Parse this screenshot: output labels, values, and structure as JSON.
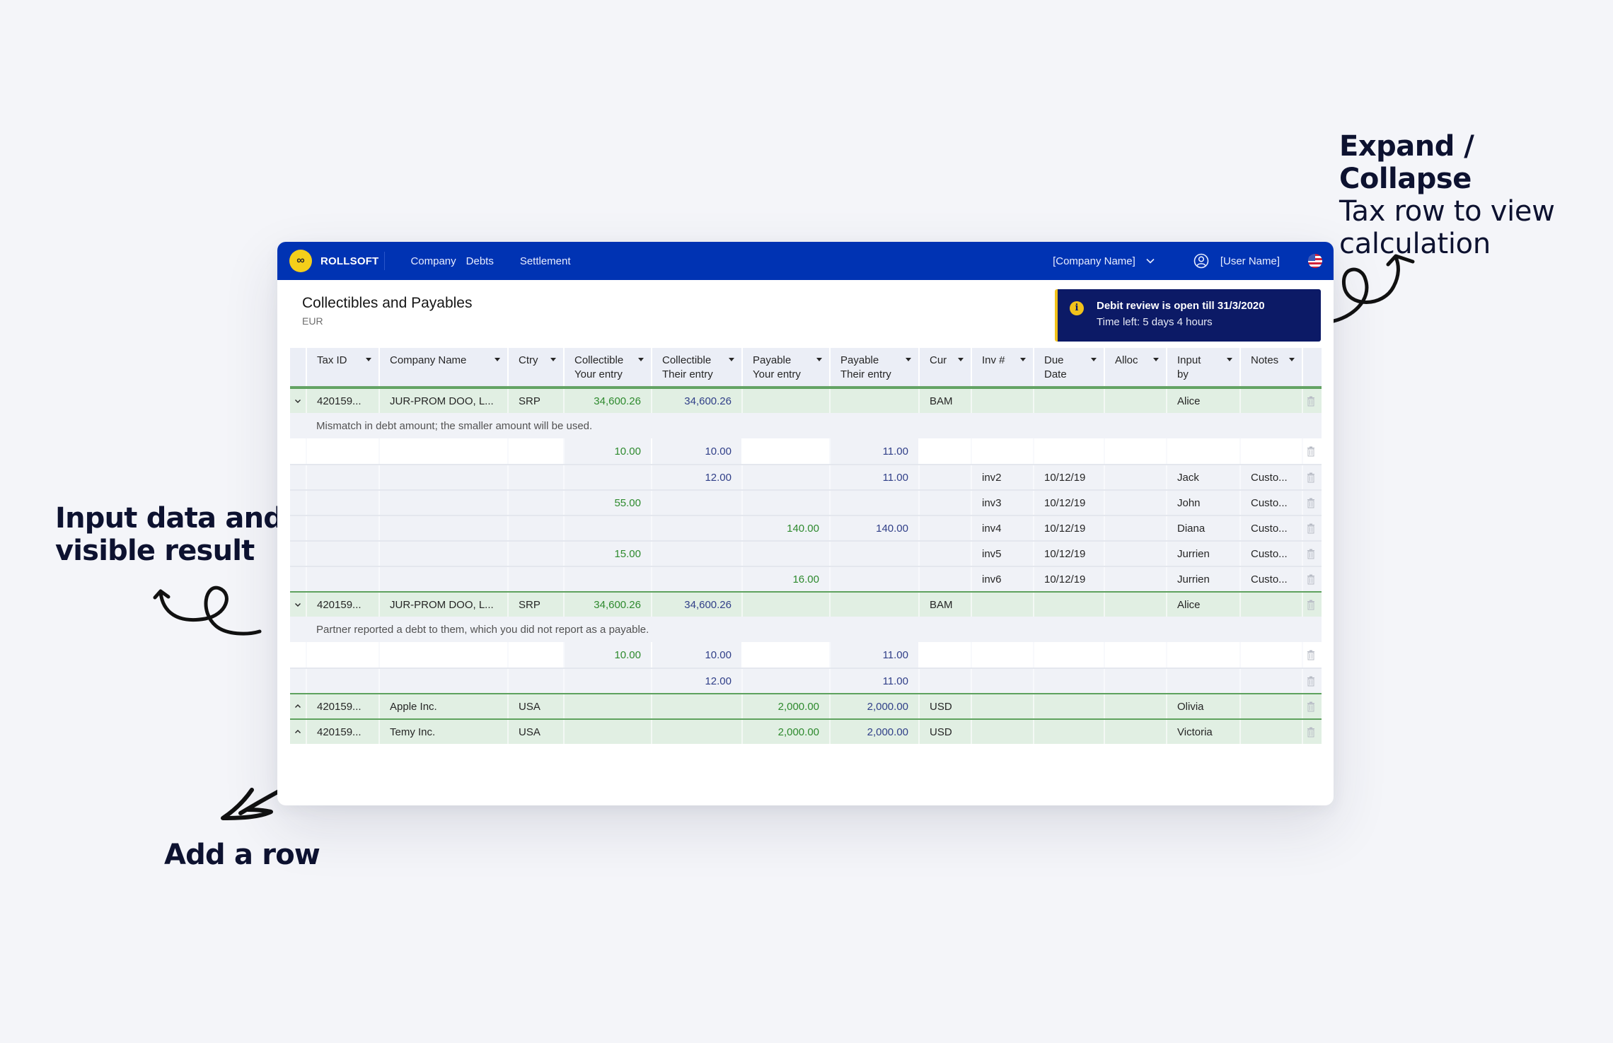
{
  "annotations": {
    "expand_title": "Expand / Collapse",
    "expand_body_1": "Tax row to view",
    "expand_body_2": "calculation",
    "input_line_1": "Input data and",
    "input_line_2": "visible result",
    "add_row": "Add a row"
  },
  "app": {
    "logo_glyph": "∞",
    "brand": "ROLLSOFT",
    "nav": [
      "Company",
      "Debts",
      "Settlement"
    ],
    "company_select": "[Company Name]",
    "user_name": "[User Name]",
    "locale": "en-US"
  },
  "page": {
    "title": "Collectibles and Payables",
    "currency": "EUR"
  },
  "notice": {
    "icon": "info-icon",
    "title": "Debit review is open till 31/3/2020",
    "subtitle": "Time left: 5 days 4 hours",
    "accent": "#f1c21b"
  },
  "colors": {
    "brand_blue": "#0033b3",
    "your_entry": "#2e8a2e",
    "their_entry": "#303f88",
    "tax_row_bg": "#e1efe3"
  },
  "table": {
    "headers": [
      {
        "l1": "Tax ID",
        "l2": ""
      },
      {
        "l1": "Company Name",
        "l2": ""
      },
      {
        "l1": "Ctry",
        "l2": ""
      },
      {
        "l1": "Collectible",
        "l2": "Your entry"
      },
      {
        "l1": "Collectible",
        "l2": "Their entry"
      },
      {
        "l1": "Payable",
        "l2": "Your entry"
      },
      {
        "l1": "Payable",
        "l2": "Their entry"
      },
      {
        "l1": "Cur",
        "l2": ""
      },
      {
        "l1": "Inv #",
        "l2": ""
      },
      {
        "l1": "Due",
        "l2": "Date"
      },
      {
        "l1": "Alloc",
        "l2": ""
      },
      {
        "l1": "Input",
        "l2": "by"
      },
      {
        "l1": "Notes",
        "l2": ""
      }
    ],
    "groups": [
      {
        "expanded": true,
        "tax": {
          "tax_id": "420159...",
          "company": "JUR-PROM DOO, L...",
          "ctry": "SRP",
          "coll_your": "34,600.26",
          "coll_their": "34,600.26",
          "pay_your": "",
          "pay_their": "",
          "cur": "BAM",
          "inv": "",
          "due": "",
          "alloc": "",
          "input_by": "Alice",
          "notes": ""
        },
        "message": "Mismatch in debt amount; the smaller amount will be used.",
        "details": [
          {
            "coll_your": "10.00",
            "coll_their": "10.00",
            "pay_your": "",
            "pay_their": "11.00",
            "inv": "",
            "due": "",
            "input_by": "",
            "notes": ""
          },
          {
            "coll_your": "",
            "coll_their": "12.00",
            "pay_your": "",
            "pay_their": "11.00",
            "inv": "inv2",
            "due": "10/12/19",
            "input_by": "Jack",
            "notes": "Custo..."
          },
          {
            "coll_your": "55.00",
            "coll_their": "",
            "pay_your": "",
            "pay_their": "",
            "inv": "inv3",
            "due": "10/12/19",
            "input_by": "John",
            "notes": "Custo..."
          },
          {
            "coll_your": "",
            "coll_their": "",
            "pay_your": "140.00",
            "pay_their": "140.00",
            "inv": "inv4",
            "due": "10/12/19",
            "input_by": "Diana",
            "notes": "Custo..."
          },
          {
            "coll_your": "15.00",
            "coll_their": "",
            "pay_your": "",
            "pay_their": "",
            "inv": "inv5",
            "due": "10/12/19",
            "input_by": "Jurrien",
            "notes": "Custo..."
          },
          {
            "coll_your": "",
            "coll_their": "",
            "pay_your": "16.00",
            "pay_their": "",
            "inv": "inv6",
            "due": "10/12/19",
            "input_by": "Jurrien",
            "notes": "Custo..."
          }
        ]
      },
      {
        "expanded": true,
        "tax": {
          "tax_id": "420159...",
          "company": "JUR-PROM DOO, L...",
          "ctry": "SRP",
          "coll_your": "34,600.26",
          "coll_their": "34,600.26",
          "pay_your": "",
          "pay_their": "",
          "cur": "BAM",
          "inv": "",
          "due": "",
          "alloc": "",
          "input_by": "Alice",
          "notes": ""
        },
        "message": "Partner reported a debt to them, which you did not report as a payable.",
        "details": [
          {
            "coll_your": "10.00",
            "coll_their": "10.00",
            "pay_your": "",
            "pay_their": "11.00",
            "inv": "",
            "due": "",
            "input_by": "",
            "notes": ""
          },
          {
            "coll_your": "",
            "coll_their": "12.00",
            "pay_your": "",
            "pay_their": "11.00",
            "inv": "",
            "due": "",
            "input_by": "",
            "notes": ""
          }
        ]
      },
      {
        "expanded": false,
        "tax": {
          "tax_id": "420159...",
          "company": "Apple Inc.",
          "ctry": "USA",
          "coll_your": "",
          "coll_their": "",
          "pay_your": "2,000.00",
          "pay_their": "2,000.00",
          "cur": "USD",
          "inv": "",
          "due": "",
          "alloc": "",
          "input_by": "Olivia",
          "notes": ""
        },
        "message": "",
        "details": []
      },
      {
        "expanded": false,
        "tax": {
          "tax_id": "420159...",
          "company": "Temy Inc.",
          "ctry": "USA",
          "coll_your": "",
          "coll_their": "",
          "pay_your": "2,000.00",
          "pay_their": "2,000.00",
          "cur": "USD",
          "inv": "",
          "due": "",
          "alloc": "",
          "input_by": "Victoria",
          "notes": ""
        },
        "message": "",
        "details": []
      }
    ]
  }
}
